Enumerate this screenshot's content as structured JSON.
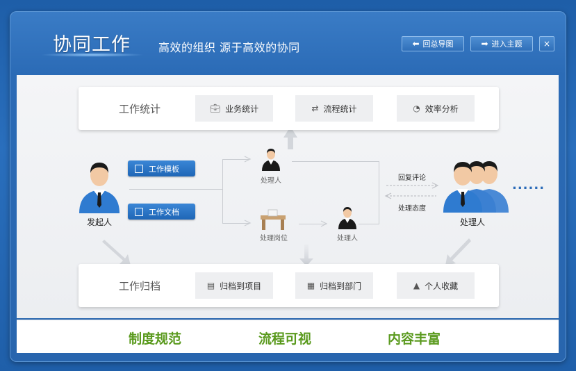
{
  "header": {
    "title": "协同工作",
    "subtitle": "高效的组织   源于高效的协同",
    "back_button": "回总导图",
    "enter_button": "进入主题",
    "close_button": "×"
  },
  "stats_panel": {
    "label": "工作统计",
    "items": [
      {
        "label": "业务统计",
        "icon": "briefcase-icon"
      },
      {
        "label": "流程统计",
        "icon": "flow-icon"
      },
      {
        "label": "效率分析",
        "icon": "clock-icon"
      }
    ]
  },
  "archive_panel": {
    "label": "工作归档",
    "items": [
      {
        "label": "归档到项目",
        "icon": "document-icon"
      },
      {
        "label": "归档到部门",
        "icon": "building-icon"
      },
      {
        "label": "个人收藏",
        "icon": "person-icon"
      }
    ]
  },
  "flow": {
    "initiator": "发起人",
    "template_button": "工作模板",
    "document_button": "工作文档",
    "handler_top": "处理人",
    "handler_post": "处理岗位",
    "handler_bottom": "处理人",
    "reply": "回复评论",
    "attitude": "处理态度",
    "handlers_group": "处理人",
    "more": "......"
  },
  "footer": {
    "items": [
      "制度规范",
      "流程可视",
      "内容丰富"
    ]
  },
  "colors": {
    "background": "#2a6fbd",
    "accent_green": "#5a9a1e",
    "button_blue": "#1f66b6"
  }
}
